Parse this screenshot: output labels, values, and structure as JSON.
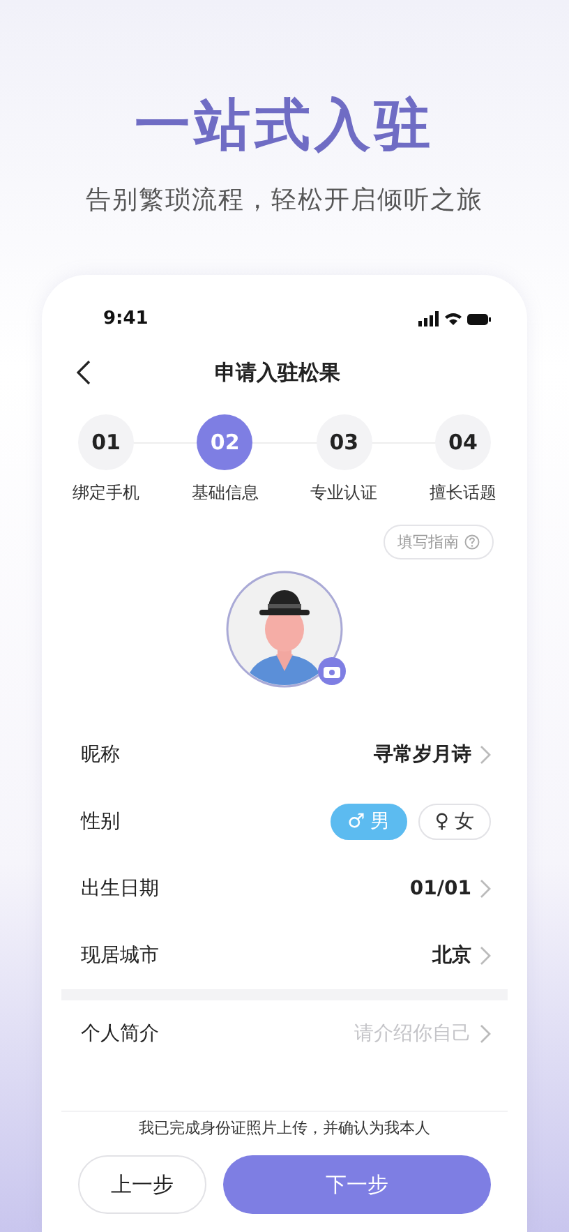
{
  "headline": "一站式入驻",
  "subheadline": "告别繁琐流程，轻松开启倾听之旅",
  "status_bar": {
    "time": "9:41"
  },
  "nav": {
    "title": "申请入驻松果"
  },
  "steps": [
    {
      "number": "01",
      "label": "绑定手机",
      "selected": false
    },
    {
      "number": "02",
      "label": "基础信息",
      "selected": true
    },
    {
      "number": "03",
      "label": "专业认证",
      "selected": false
    },
    {
      "number": "04",
      "label": "擅长话题",
      "selected": false
    }
  ],
  "guide_button": {
    "label": "填写指南"
  },
  "form_rows": [
    {
      "kind": "value",
      "label": "昵称",
      "value": "寻常岁月诗"
    },
    {
      "kind": "gender",
      "label": "性别",
      "options": [
        {
          "symbol": "♂",
          "label": "男",
          "selected": true
        },
        {
          "symbol": "♀",
          "label": "女",
          "selected": false
        }
      ]
    },
    {
      "kind": "value",
      "label": "出生日期",
      "value": "01/01"
    },
    {
      "kind": "value",
      "label": "现居城市",
      "value": "北京"
    },
    {
      "kind": "divider"
    },
    {
      "kind": "placeholder",
      "label": "个人简介",
      "placeholder": "请介绍你自己"
    }
  ],
  "notice": "我已完成身份证照片上传，并确认为我本人",
  "buttons": {
    "prev": "上一步",
    "next": "下一步"
  }
}
